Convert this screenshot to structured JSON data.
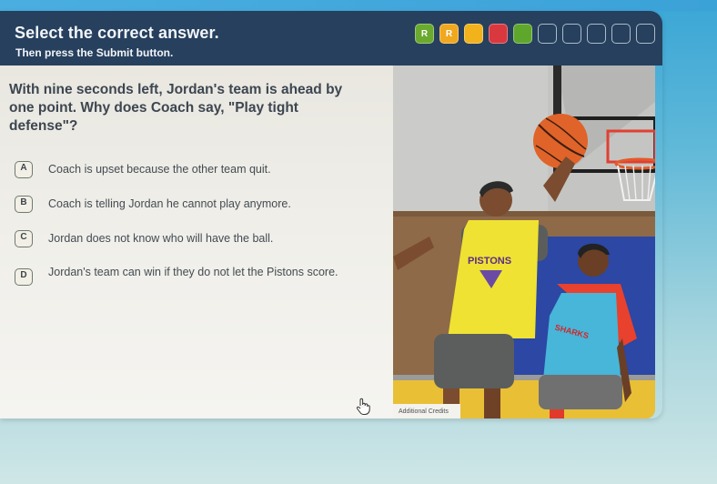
{
  "header": {
    "title": "Select the correct answer.",
    "subtitle": "Then press the Submit button."
  },
  "progress": {
    "items": [
      {
        "state": "correct",
        "label": "R",
        "color": "#6aaa2e"
      },
      {
        "state": "partial",
        "label": "R",
        "color": "#f0a820"
      },
      {
        "state": "partial",
        "label": "",
        "color": "#f2b21c"
      },
      {
        "state": "incorrect",
        "label": "",
        "color": "#d8383e"
      },
      {
        "state": "correct",
        "label": "",
        "color": "#5ea72c"
      },
      {
        "state": "empty",
        "label": "",
        "color": ""
      },
      {
        "state": "empty",
        "label": "",
        "color": ""
      },
      {
        "state": "empty",
        "label": "",
        "color": ""
      },
      {
        "state": "empty",
        "label": "",
        "color": ""
      },
      {
        "state": "empty",
        "label": "",
        "color": ""
      }
    ]
  },
  "question": {
    "text": "With nine seconds left, Jordan's team is ahead by one point. Why does Coach say, \"Play tight defense\"?"
  },
  "options": [
    {
      "letter": "A",
      "text": "Coach is upset because the other team quit."
    },
    {
      "letter": "B",
      "text": "Coach is telling Jordan he cannot play anymore."
    },
    {
      "letter": "C",
      "text": "Jordan does not know who will have the ball."
    },
    {
      "letter": "D",
      "text": "Jordan's team can win if they do not let the Pistons score."
    }
  ],
  "image": {
    "description": "Illustration of two boys playing basketball; one in a yellow Pistons jersey reaching for the ball near the hoop, the other in a blue jersey",
    "jersey_text_left": "PISTONS",
    "credits_label": "Additional Credits"
  },
  "colors": {
    "header_bg": "#26405e",
    "panel_bg": "#efede7",
    "accent_blue": "#3aa6d6"
  }
}
